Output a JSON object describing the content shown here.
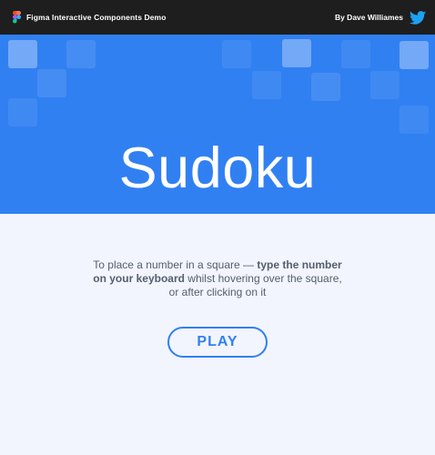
{
  "topbar": {
    "title": "Figma Interactive Components Demo",
    "author": "By Dave Williames",
    "logo_icon": "figma-logo-icon",
    "social_icon": "twitter-icon"
  },
  "hero": {
    "title": "Sudoku",
    "background_color": "#3180f2"
  },
  "main": {
    "instructions_before": "To place a number in a square — ",
    "instructions_bold": "type the number on your keyboard",
    "instructions_after": " whilst hovering over the square, or after clicking on it",
    "play_label": "PLAY",
    "accent_color": "#3180f2"
  }
}
